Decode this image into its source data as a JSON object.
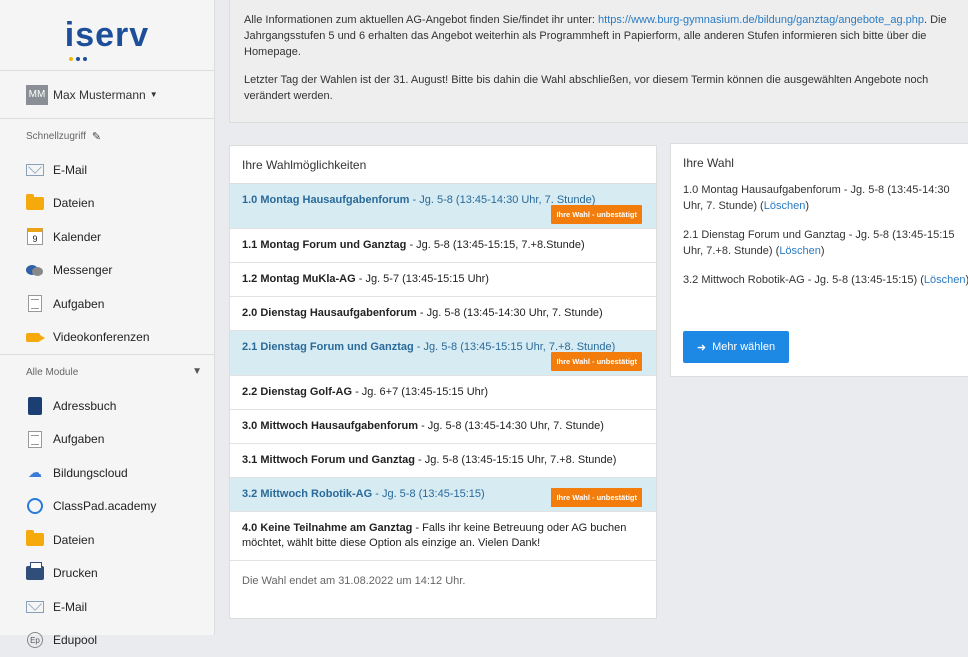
{
  "logo": {
    "text": "iserv"
  },
  "user": {
    "initials": "MM",
    "name": "Max Mustermann"
  },
  "sidebar": {
    "quick_access_label": "Schnellzugriff",
    "quick_items": [
      {
        "label": "E-Mail",
        "icon": "mail-icon"
      },
      {
        "label": "Dateien",
        "icon": "folder-icon"
      },
      {
        "label": "Kalender",
        "icon": "calendar-icon"
      },
      {
        "label": "Messenger",
        "icon": "chat-icon"
      },
      {
        "label": "Aufgaben",
        "icon": "document-icon"
      },
      {
        "label": "Videokonferenzen",
        "icon": "video-icon"
      }
    ],
    "all_modules_label": "Alle Module",
    "module_items": [
      {
        "label": "Adressbuch",
        "icon": "book-icon"
      },
      {
        "label": "Aufgaben",
        "icon": "document-icon"
      },
      {
        "label": "Bildungscloud",
        "icon": "cloud-icon"
      },
      {
        "label": "ClassPad.academy",
        "icon": "classpad-icon"
      },
      {
        "label": "Dateien",
        "icon": "folder-icon"
      },
      {
        "label": "Drucken",
        "icon": "printer-icon"
      },
      {
        "label": "E-Mail",
        "icon": "mail-icon"
      },
      {
        "label": "Edupool",
        "icon": "edupool-icon"
      }
    ]
  },
  "info": {
    "para1_prefix": "Alle Informationen zum aktuellen AG-Angebot finden Sie/findet ihr unter: ",
    "para1_link": "https://www.burg-gymnasium.de/bildung/ganztag/angebote_ag.php",
    "para1_suffix": ". Die Jahrgangsstufen 5 und 6 erhalten das Angebot weiterhin als Programmheft in Papierform, alle anderen Stufen informieren sich bitte über die Homepage.",
    "para2": "Letzter Tag der Wahlen ist der 31. August! Bitte bis dahin die Wahl abschließen, vor diesem Termin können die ausgewählten Angebote noch verändert werden."
  },
  "choices": {
    "title": "Ihre Wahlmöglichkeiten",
    "badge": "Ihre Wahl - unbestätigt",
    "options": [
      {
        "name": "1.0 Montag Hausaufgabenforum",
        "detail": " - Jg. 5-8 (13:45-14:30 Uhr, 7. Stunde)",
        "selected": true
      },
      {
        "name": "1.1 Montag Forum und Ganztag",
        "detail": " - Jg. 5-8 (13:45-15:15, 7.+8.Stunde)",
        "selected": false
      },
      {
        "name": "1.2 Montag MuKla-AG",
        "detail": " - Jg. 5-7 (13:45-15:15 Uhr)",
        "selected": false
      },
      {
        "name": "2.0 Dienstag Hausaufgabenforum",
        "detail": " - Jg. 5-8 (13:45-14:30 Uhr, 7. Stunde)",
        "selected": false
      },
      {
        "name": "2.1 Dienstag Forum und Ganztag",
        "detail": " - Jg. 5-8 (13:45-15:15 Uhr, 7.+8. Stunde)",
        "selected": true
      },
      {
        "name": "2.2 Dienstag Golf-AG",
        "detail": " - Jg. 6+7 (13:45-15:15 Uhr)",
        "selected": false
      },
      {
        "name": "3.0 Mittwoch Hausaufgabenforum",
        "detail": " - Jg. 5-8 (13:45-14:30 Uhr, 7. Stunde)",
        "selected": false
      },
      {
        "name": "3.1 Mittwoch Forum und Ganztag",
        "detail": " - Jg. 5-8 (13:45-15:15 Uhr, 7.+8. Stunde)",
        "selected": false
      },
      {
        "name": "3.2 Mittwoch Robotik-AG",
        "detail": " - Jg. 5-8 (13:45-15:15)",
        "selected": true
      },
      {
        "name": "4.0 Keine Teilnahme am Ganztag",
        "detail": " - Falls ihr keine Betreuung oder AG buchen möchtet, wählt bitte diese Option als einzige an. Vielen Dank!",
        "selected": false
      }
    ],
    "footer": "Die Wahl endet am 31.08.2022 um 14:12 Uhr."
  },
  "wahl": {
    "title": "Ihre Wahl",
    "delete_label": "Löschen",
    "items": [
      {
        "text": "1.0 Montag Hausaufgabenforum - Jg. 5-8 (13:45-14:30 Uhr, 7. Stunde) ("
      },
      {
        "text": "2.1 Dienstag Forum und Ganztag - Jg. 5-8 (13:45-15:15 Uhr, 7.+8. Stunde) ("
      },
      {
        "text": "3.2 Mittwoch Robotik-AG - Jg. 5-8 (13:45-15:15) ("
      }
    ],
    "more_button": "Mehr wählen"
  }
}
